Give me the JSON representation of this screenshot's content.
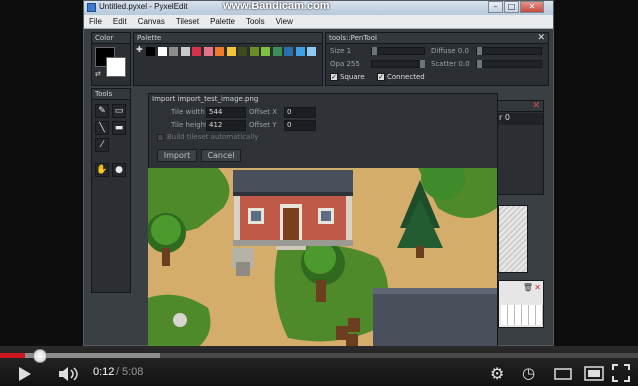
{
  "window": {
    "title": "Untitled.pyxel - PyxelEdit",
    "watermark": "www.Bandicam.com"
  },
  "menu": [
    "File",
    "Edit",
    "Canvas",
    "Tileset",
    "Palette",
    "Tools",
    "View"
  ],
  "panels": {
    "color": {
      "title": "Color"
    },
    "palette": {
      "title": "Palette",
      "swatches": [
        "#000000",
        "#ffffff",
        "#8c8c8c",
        "#c9c9c9",
        "#d9314a",
        "#e6748a",
        "#f07a2a",
        "#f5c23a",
        "#3e4b1c",
        "#6b8e23",
        "#7fc043",
        "#3c8f5a",
        "#2a6fb0",
        "#3ea0e6",
        "#8fc9f0"
      ]
    },
    "tools": {
      "title": "Tools"
    },
    "pentool": {
      "title": "tools::PenTool",
      "size_label": "Size 1",
      "diffuse_label": "Diffuse 0.0",
      "opacity_label": "Opa 255",
      "scatter_label": "Scatter 0.0",
      "square_label": "Square",
      "connected_label": "Connected",
      "layer_fragment": "r 0"
    }
  },
  "import_dialog": {
    "title": "Import import_test_image.png",
    "tile_width_label": "Tile width",
    "tile_width_value": "544",
    "offset_x_label": "Offset X",
    "offset_x_value": "0",
    "tile_height_label": "Tile height",
    "tile_height_value": "412",
    "offset_y_label": "Offset Y",
    "offset_y_value": "0",
    "build_tileset_label": "Build tileset automatically",
    "import_button": "Import",
    "cancel_button": "Cancel"
  },
  "player": {
    "time_current": "0:12",
    "time_separator": "/",
    "time_total": "5:08",
    "played_fraction": 0.039,
    "buffered_fraction": 0.25
  },
  "colors": {
    "progress_red": "#cc181e",
    "panel_bg": "#2b2f33"
  }
}
